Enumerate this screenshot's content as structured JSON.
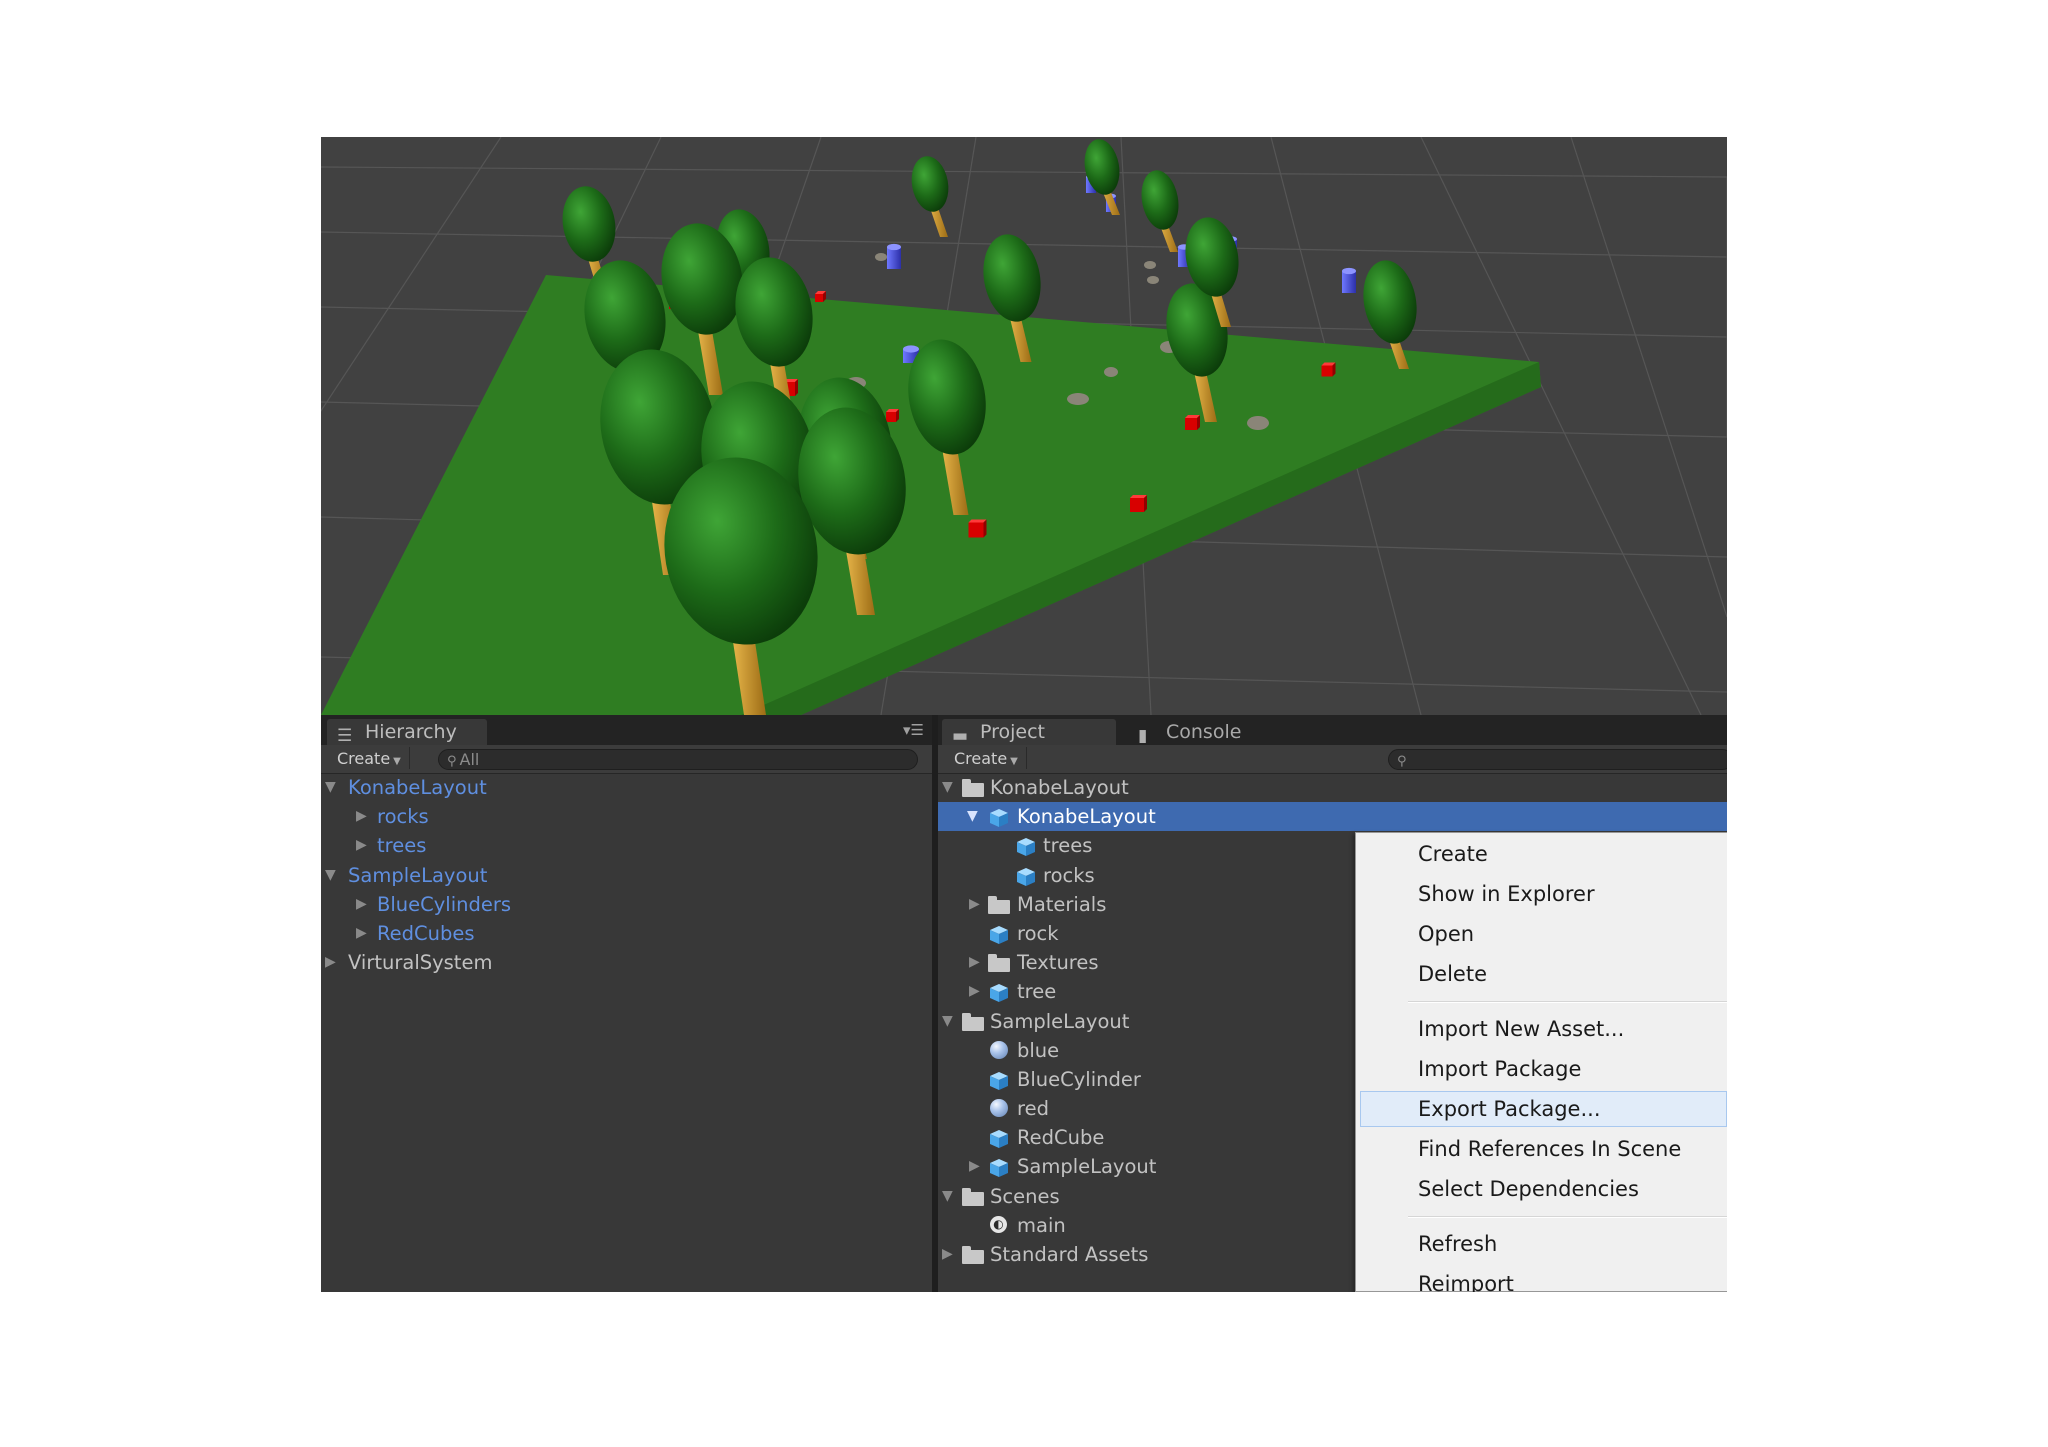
{
  "colors": {
    "scene_background": "#414141",
    "ground": "#2f7d22",
    "panel_background": "#383838",
    "blue_text": "#5f8fe0",
    "selection": "#3e6ab0",
    "menu_background": "#f0f0f0"
  },
  "hierarchy": {
    "tab_label": "Hierarchy",
    "tab_icon": "list-icon",
    "create_label": "Create",
    "search_placeholder": "All",
    "items": [
      {
        "label": "KonabeLayout",
        "expanded": true
      },
      {
        "label": "rocks",
        "expanded": false
      },
      {
        "label": "trees",
        "expanded": false
      },
      {
        "label": "SampleLayout",
        "expanded": true
      },
      {
        "label": "BlueCylinders",
        "expanded": false
      },
      {
        "label": "RedCubes",
        "expanded": false
      },
      {
        "label": "VirturalSystem",
        "expanded": false
      }
    ]
  },
  "project": {
    "tab_label": "Project",
    "tab_icon": "folder-icon",
    "console_tab_label": "Console",
    "console_tab_icon": "console-icon",
    "create_label": "Create",
    "search_placeholder": "",
    "items": [
      {
        "label": "KonabeLayout",
        "type": "folder",
        "expanded": true
      },
      {
        "label": "KonabeLayout",
        "type": "prefab",
        "expanded": true,
        "selected": true
      },
      {
        "label": "trees",
        "type": "prefab"
      },
      {
        "label": "rocks",
        "type": "prefab"
      },
      {
        "label": "Materials",
        "type": "folder",
        "expanded": false
      },
      {
        "label": "rock",
        "type": "prefab"
      },
      {
        "label": "Textures",
        "type": "folder",
        "expanded": false
      },
      {
        "label": "tree",
        "type": "prefab",
        "expanded": false
      },
      {
        "label": "SampleLayout",
        "type": "folder",
        "expanded": true
      },
      {
        "label": "blue",
        "type": "material"
      },
      {
        "label": "BlueCylinder",
        "type": "prefab"
      },
      {
        "label": "red",
        "type": "material"
      },
      {
        "label": "RedCube",
        "type": "prefab"
      },
      {
        "label": "SampleLayout",
        "type": "prefab",
        "expanded": false
      },
      {
        "label": "Scenes",
        "type": "folder",
        "expanded": true
      },
      {
        "label": "main",
        "type": "scene"
      },
      {
        "label": "Standard Assets",
        "type": "folder",
        "expanded": false
      }
    ]
  },
  "context_menu": {
    "items": [
      "Create",
      "Show in Explorer",
      "Open",
      "Delete",
      "Import New Asset...",
      "Import Package",
      "Export Package...",
      "Find References In Scene",
      "Select Dependencies",
      "Refresh",
      "Reimport"
    ],
    "highlighted": "Export Package..."
  }
}
